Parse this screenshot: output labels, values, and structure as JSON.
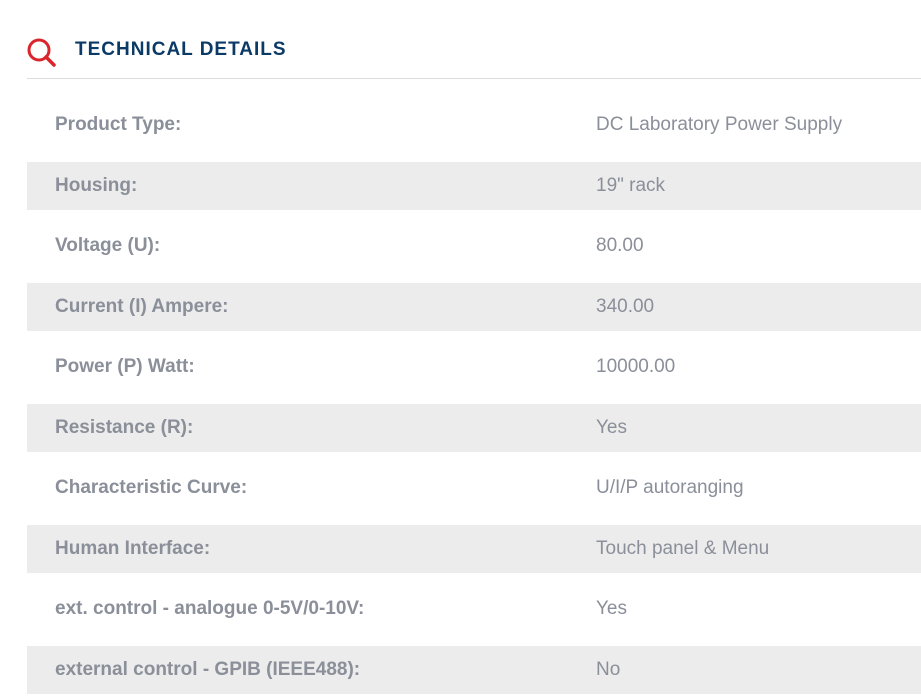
{
  "section": {
    "title": "TECHNICAL DETAILS",
    "icon": "search-icon",
    "icon_color": "#d9252b",
    "title_color": "#0b3a66"
  },
  "details": [
    {
      "label": "Product Type:",
      "value": "DC Laboratory Power Supply"
    },
    {
      "label": "Housing:",
      "value": "19\" rack"
    },
    {
      "label": "Voltage (U):",
      "value": "80.00"
    },
    {
      "label": "Current (I) Ampere:",
      "value": "340.00"
    },
    {
      "label": "Power (P) Watt:",
      "value": "10000.00"
    },
    {
      "label": "Resistance (R):",
      "value": "Yes"
    },
    {
      "label": "Characteristic Curve:",
      "value": "U/I/P autoranging"
    },
    {
      "label": "Human Interface:",
      "value": "Touch panel & Menu"
    },
    {
      "label": "ext. control - analogue 0-5V/0-10V:",
      "value": "Yes"
    },
    {
      "label": "external control - GPIB (IEEE488):",
      "value": "No"
    }
  ]
}
